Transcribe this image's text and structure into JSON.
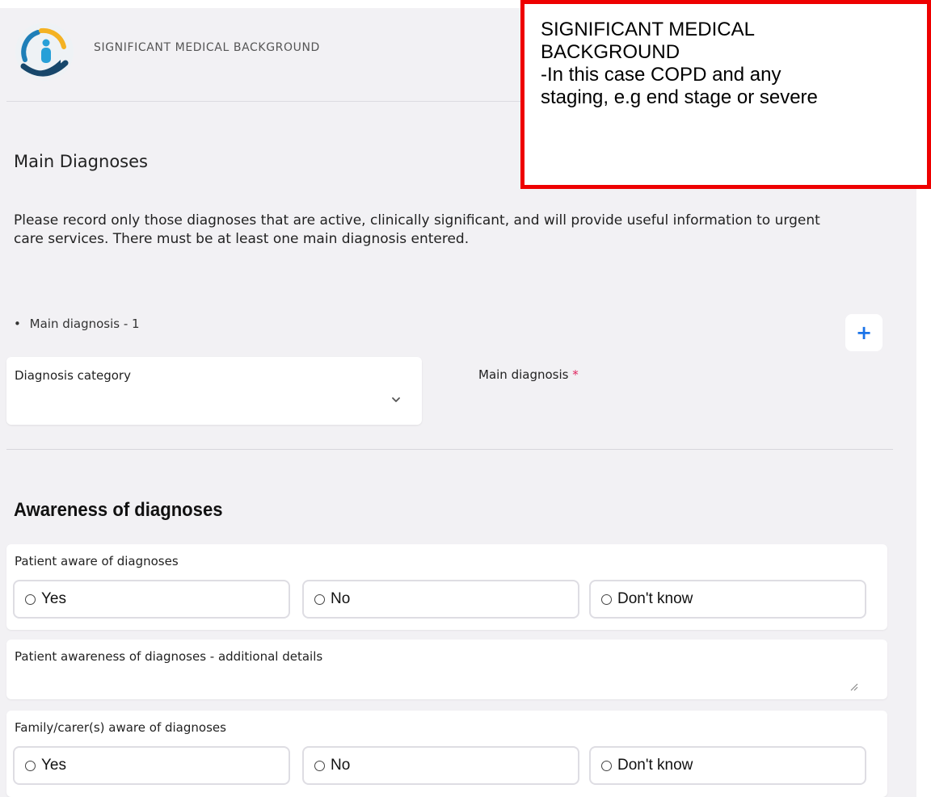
{
  "header": {
    "title": "SIGNIFICANT MEDICAL BACKGROUND"
  },
  "annotation": {
    "text": "SIGNIFICANT MEDICAL\nBACKGROUND\n-In this case COPD and any\nstaging, e.g end stage or severe"
  },
  "main_diagnoses": {
    "title": "Main Diagnoses",
    "intro": "Please record only those diagnoses that are active, clinically significant, and will provide useful information to urgent care services. There must be at least one main diagnosis entered.",
    "bullet": "•",
    "item_label": "Main diagnosis - 1",
    "add_label": "+",
    "category_label": "Diagnosis category",
    "category_value": "",
    "main_diagnosis_label": "Main diagnosis",
    "required_marker": "*"
  },
  "awareness": {
    "title": "Awareness of diagnoses",
    "patient_aware": {
      "label": "Patient aware of diagnoses",
      "options": [
        "Yes",
        "No",
        "Don't know"
      ]
    },
    "patient_details": {
      "label": "Patient awareness of diagnoses - additional details",
      "value": ""
    },
    "family_aware": {
      "label": "Family/carer(s) aware of diagnoses",
      "options": [
        "Yes",
        "No",
        "Don't know"
      ]
    }
  },
  "colors": {
    "accent": "#1a73e8",
    "required": "#e0245e",
    "annotation_border": "#ee0000",
    "page_background": "#f2f1f4"
  },
  "icons": [
    "logo-icon",
    "plus-icon",
    "chevron-down-icon",
    "radio-icon",
    "resize-handle-icon"
  ]
}
